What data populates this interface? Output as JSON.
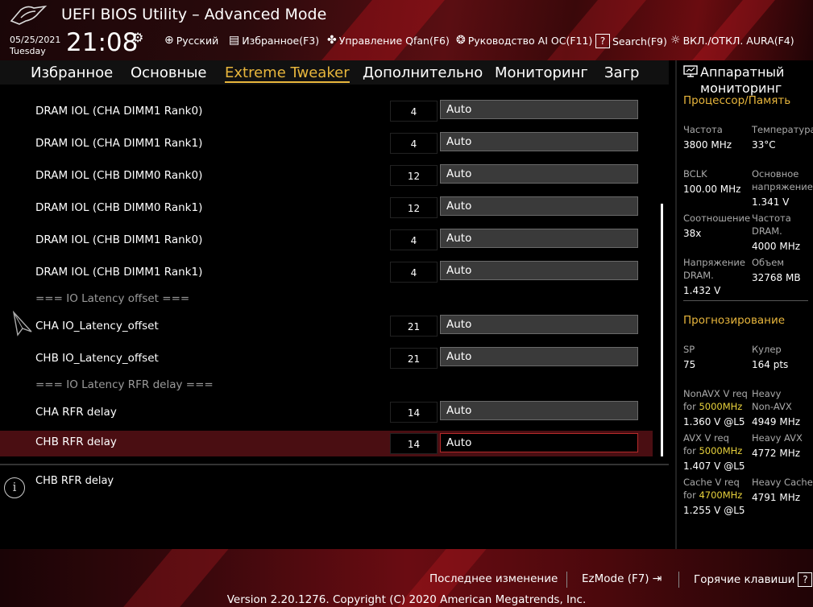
{
  "header": {
    "title": "UEFI BIOS Utility – Advanced Mode",
    "date": "05/25/2021",
    "day": "Tuesday",
    "time": "21:08",
    "toolbar": [
      {
        "icon": "globe-icon",
        "label": "Русский"
      },
      {
        "icon": "favorites-icon",
        "label": "Избранное(F3)"
      },
      {
        "icon": "fan-icon",
        "label": "Управление Qfan(F6)"
      },
      {
        "icon": "ai-oc-icon",
        "label": "Руководство AI OC(F11)"
      },
      {
        "icon": "search-help-icon",
        "label": "Search(F9)"
      },
      {
        "icon": "aura-icon",
        "label": "ВКЛ./ОТКЛ. AURA(F4)"
      }
    ]
  },
  "tabs": [
    {
      "label": "Избранное"
    },
    {
      "label": "Основные"
    },
    {
      "label": "Extreme Tweaker",
      "active": true
    },
    {
      "label": "Дополнительно"
    },
    {
      "label": "Мониторинг"
    },
    {
      "label": "Загр"
    }
  ],
  "settings": {
    "rows": [
      {
        "label": "DRAM IOL (CHA DIMM1 Rank0)",
        "current": "4",
        "value": "Auto"
      },
      {
        "label": "DRAM IOL (CHA DIMM1 Rank1)",
        "current": "4",
        "value": "Auto"
      },
      {
        "label": "DRAM IOL (CHB DIMM0 Rank0)",
        "current": "12",
        "value": "Auto"
      },
      {
        "label": "DRAM IOL (CHB DIMM0 Rank1)",
        "current": "12",
        "value": "Auto"
      },
      {
        "label": "DRAM IOL (CHB DIMM1 Rank0)",
        "current": "4",
        "value": "Auto"
      },
      {
        "label": "DRAM IOL (CHB DIMM1 Rank1)",
        "current": "4",
        "value": "Auto"
      },
      {
        "label": "CHA IO_Latency_offset",
        "current": "21",
        "value": "Auto"
      },
      {
        "label": "CHB IO_Latency_offset",
        "current": "21",
        "value": "Auto"
      },
      {
        "label": "CHA RFR delay",
        "current": "14",
        "value": "Auto"
      },
      {
        "label": "CHB RFR delay",
        "current": "14",
        "value": "Auto",
        "selected": true
      }
    ],
    "section_io_offset": "=== IO Latency offset ===",
    "section_rfr": "=== IO Latency RFR delay ==="
  },
  "help": {
    "text": "CHB RFR delay"
  },
  "monitor": {
    "title": "Аппаратный мониторинг",
    "cpu_section": "Процессор/Память",
    "freq_label": "Частота",
    "freq_value": "3800 MHz",
    "temp_label": "Температура",
    "temp_value": "33°C",
    "bclk_label": "BCLK",
    "bclk_value": "100.00 MHz",
    "corev_label": "Основное напряжение",
    "corev_value": "1.341 V",
    "ratio_label": "Соотношение",
    "ratio_value": "38x",
    "dramfreq_label": "Частота DRAM.",
    "dramfreq_value": "4000 MHz",
    "dramv_label": "Напряжение DRAM.",
    "dramv_value": "1.432 V",
    "cap_label": "Объем",
    "cap_value": "32768 MB",
    "predict_section": "Прогнозирование",
    "sp_label": "SP",
    "sp_value": "75",
    "cooler_label": "Кулер",
    "cooler_value": "164 pts",
    "nonavx_label": "NonAVX V req",
    "nonavx_for": "for",
    "nonavx_freq": "5000MHz",
    "nonavx_value": "1.360 V @L5",
    "heavy_nonavx_label": "Heavy Non-AVX",
    "heavy_nonavx_value": "4949 MHz",
    "avx_label": "AVX V req",
    "avx_for": "for",
    "avx_freq": "5000MHz",
    "avx_value": "1.407 V @L5",
    "heavy_avx_label": "Heavy AVX",
    "heavy_avx_value": "4772 MHz",
    "cache_label": "Cache V req",
    "cache_for": "for",
    "cache_freq": "4700MHz",
    "cache_value": "1.255 V @L5",
    "heavy_cache_label": "Heavy Cache",
    "heavy_cache_value": "4791 MHz"
  },
  "footer": {
    "last_change": "Последнее изменение",
    "ezmode": "EzMode (F7)",
    "hotkeys": "Горячие клавиши",
    "hotkeys_key": "?",
    "copyright": "Version 2.20.1276. Copyright (C) 2020 American Megatrends, Inc."
  },
  "colors": {
    "accent": "#e8b63c",
    "selected_row": "#4a0e12",
    "highlight_freq": "#e8d23c"
  }
}
